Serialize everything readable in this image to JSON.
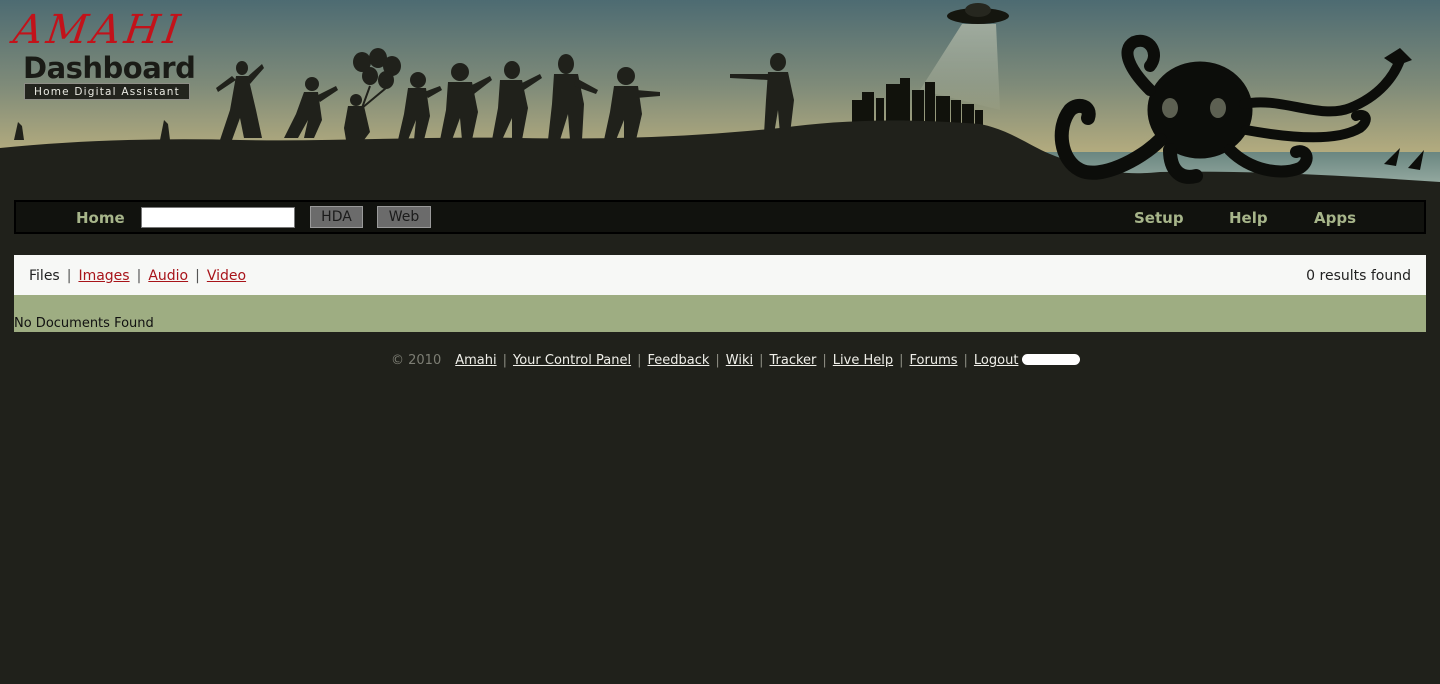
{
  "logo": {
    "title": "AMAHI",
    "subtitle": "Dashboard",
    "tagline": "Home Digital Assistant"
  },
  "nav": {
    "home_label": "Home",
    "search_value": "",
    "hda_label": "HDA",
    "web_label": "Web",
    "setup_label": "Setup",
    "help_label": "Help",
    "apps_label": "Apps"
  },
  "filters": {
    "current": "Files",
    "images": "Images",
    "audio": "Audio",
    "video": "Video",
    "separator": "|",
    "results": "0 results found"
  },
  "results": {
    "empty_message": "No Documents Found"
  },
  "footer": {
    "copyright": "© 2010",
    "links": [
      "Amahi",
      "Your Control Panel",
      "Feedback",
      "Wiki",
      "Tracker",
      "Live Help",
      "Forums",
      "Logout"
    ],
    "separator": "|"
  },
  "colors": {
    "page_background": "#20211b",
    "nav_text": "#a7b58a",
    "link_red": "#a8141a",
    "results_green": "#9ead82",
    "logo_red": "#c2121a"
  },
  "icons": [
    "ufo-icon",
    "city-skyline-icon",
    "octopus-icon",
    "zombie-silhouettes-icon",
    "balloons-icon"
  ]
}
